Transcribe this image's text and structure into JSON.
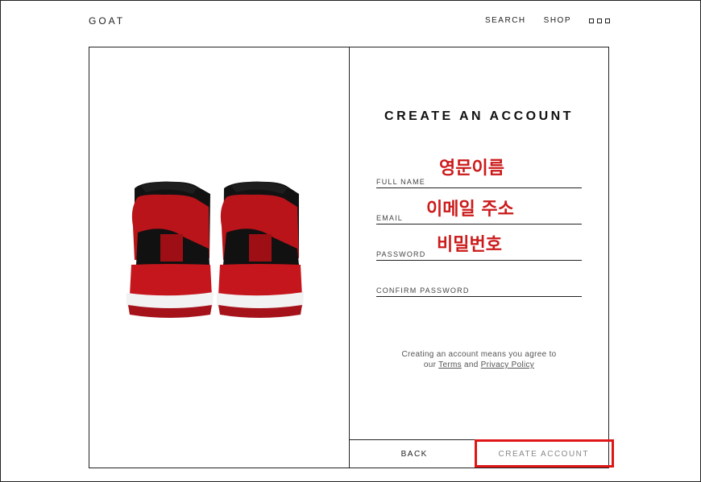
{
  "header": {
    "logo": "GOAT",
    "nav": {
      "search_label": "SEARCH",
      "shop_label": "SHOP"
    }
  },
  "form": {
    "title": "CREATE AN ACCOUNT",
    "fields": [
      {
        "label": "FULL NAME",
        "overlay": "영문이름"
      },
      {
        "label": "EMAIL",
        "overlay": "이메일 주소"
      },
      {
        "label": "PASSWORD",
        "overlay": "비밀번호"
      },
      {
        "label": "CONFIRM PASSWORD",
        "overlay": ""
      }
    ],
    "agreement": {
      "line1": "Creating an account means you agree to",
      "prefix": "our",
      "terms": "Terms",
      "and": "and",
      "privacy": "Privacy Policy"
    }
  },
  "footer": {
    "back_label": "BACK",
    "create_label": "CREATE ACCOUNT"
  },
  "colors": {
    "accent_red": "#e01515",
    "overlay_red": "#cc1a1a",
    "line": "#222222"
  },
  "icons": {
    "more": "more-dots-icon",
    "product": "sneaker-image"
  }
}
